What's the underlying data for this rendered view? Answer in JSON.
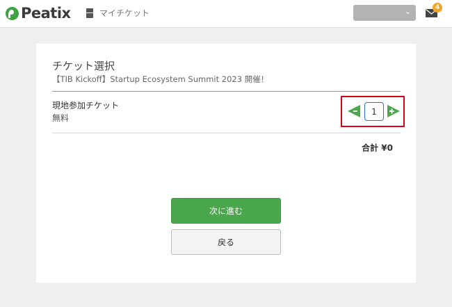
{
  "header": {
    "logo_text": "Peatix",
    "my_ticket_label": "マイチケット",
    "account_selected": "",
    "mail_badge_count": "4"
  },
  "ticket_selection": {
    "title": "チケット選択",
    "event_title": "【TIB Kickoff】Startup Ecosystem Summit 2023 開催！",
    "tickets": [
      {
        "name": "現地参加チケット",
        "price": "無料",
        "quantity": "1"
      }
    ],
    "total_label": "合計 ¥0"
  },
  "actions": {
    "next_label": "次に進む",
    "back_label": "戻る"
  },
  "colors": {
    "brand_green": "#4aa74c",
    "highlight_red": "#d0021b",
    "badge_orange": "#f0a62a",
    "input_focus_blue": "#2f6fd6"
  }
}
